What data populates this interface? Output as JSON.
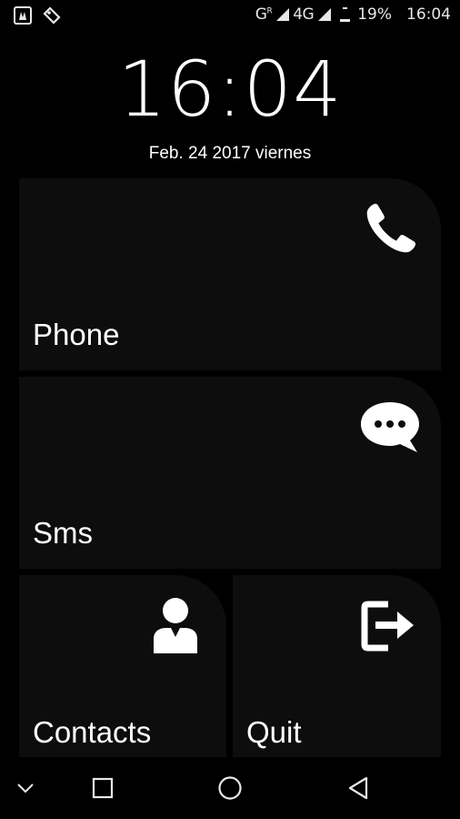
{
  "status_bar": {
    "notifications": [
      "usb-debug-icon",
      "tag-icon"
    ],
    "network_1_label": "G",
    "network_1_sub": "R",
    "network_2_label": "4G",
    "battery_percent": "19%",
    "battery_level": 0.19,
    "time": "16:04"
  },
  "clock": {
    "time": "16:04",
    "date": "Feb. 24 2017 viernes"
  },
  "tiles": {
    "phone": {
      "label": "Phone",
      "icon": "phone-icon"
    },
    "sms": {
      "label": "Sms",
      "icon": "chat-bubble-icon"
    },
    "contacts": {
      "label": "Contacts",
      "icon": "person-icon"
    },
    "quit": {
      "label": "Quit",
      "icon": "exit-icon"
    }
  },
  "nav_bar": {
    "buttons": [
      "collapse-icon",
      "recents-icon",
      "home-icon",
      "back-icon"
    ]
  },
  "colors": {
    "background": "#000000",
    "tile": "#0d0d0d",
    "text": "#ffffff"
  }
}
